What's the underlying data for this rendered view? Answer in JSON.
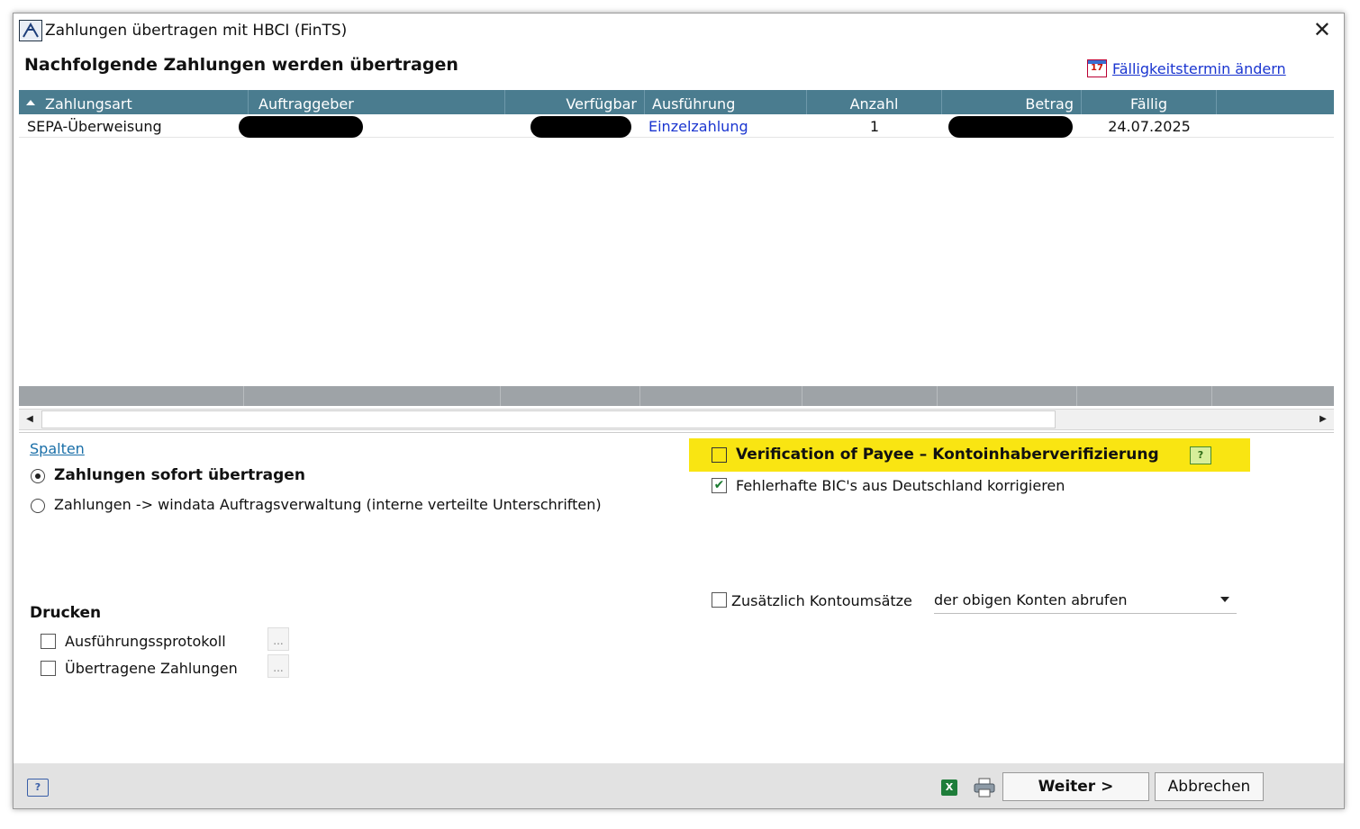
{
  "window": {
    "title": "Zahlungen übertragen mit HBCI (FinTS)",
    "close_glyph": "✕"
  },
  "header": {
    "heading": "Nachfolgende Zahlungen werden übertragen",
    "due_change_link": "Fälligkeitstermin ändern",
    "calendar_icon_text": "17"
  },
  "grid": {
    "columns": [
      "Zahlungsart",
      "Auftraggeber",
      "Verfügbar",
      "Ausführung",
      "Anzahl",
      "Betrag",
      "Fällig"
    ],
    "rows": [
      {
        "zahlungsart": "SEPA-Überweisung",
        "auftraggeber": "",
        "verfuegbar": "",
        "ausfuehrung": "Einzelzahlung",
        "anzahl": "1",
        "betrag": "",
        "faellig": "24.07.2025"
      }
    ],
    "scroll_left": "◀",
    "scroll_right": "▶"
  },
  "options": {
    "columns_link": "Spalten",
    "radio_immediate": "Zahlungen sofort übertragen",
    "radio_order_mgmt": "Zahlungen -> windata Auftragsverwaltung (interne verteilte Unterschriften)",
    "vop_label": "Verification of Payee – Kontoinhaberverifizierung",
    "bic_fix_label": "Fehlerhafte BIC's aus Deutschland korrigieren",
    "extra_statements_label": "Zusätzlich Kontoumsätze",
    "extra_statements_value": "der obigen Konten abrufen"
  },
  "print": {
    "heading": "Drucken",
    "protocol_label": "Ausführungssprotokoll",
    "transferred_label": "Übertragene Zahlungen",
    "dots": "..."
  },
  "footer": {
    "next_button": "Weiter >",
    "cancel_button": "Abbrechen",
    "help_icon_text": "?",
    "excel_icon_text": "X"
  },
  "colors": {
    "header_bg": "#4a7c8f",
    "highlight": "#f9e512",
    "link": "#1a35d0"
  },
  "icons": [
    "app-icon",
    "close-icon",
    "calendar-icon",
    "help-icon",
    "excel-icon",
    "print-icon",
    "sort-ascending-icon"
  ]
}
